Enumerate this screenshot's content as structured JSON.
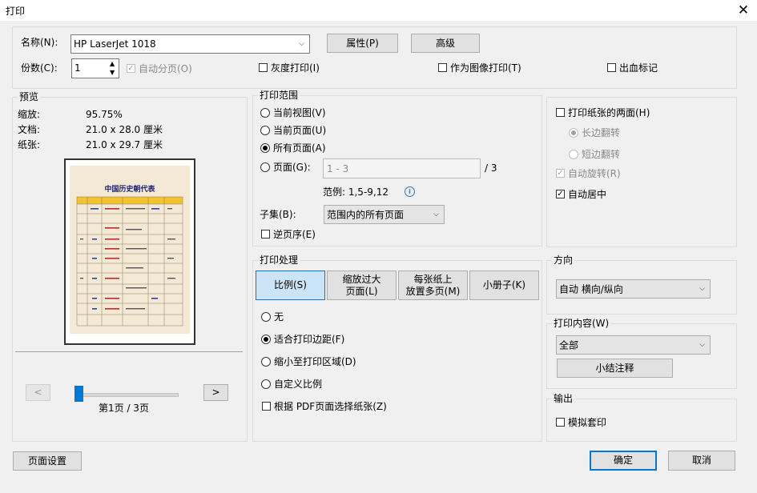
{
  "window": {
    "title": "打印",
    "close_glyph": "✕"
  },
  "printer": {
    "name_label": "名称(N):",
    "name_value": "HP LaserJet 1018",
    "properties_btn": "属性(P)",
    "advanced_btn": "高级",
    "copies_label": "份数(C):",
    "copies_value": "1",
    "collate_label": "自动分页(O)",
    "grayscale_label": "灰度打印(I)",
    "print_as_image_label": "作为图像打印(T)",
    "bleed_marks_label": "出血标记"
  },
  "preview": {
    "title": "预览",
    "zoom_label": "缩放:",
    "zoom_value": "95.75%",
    "document_label": "文档:",
    "document_value": "21.0 x 28.0 厘米",
    "paper_label": "纸张:",
    "paper_value": "21.0 x 29.7 厘米",
    "doc_heading": "中国历史朝代表",
    "prev_btn": "<",
    "next_btn": ">",
    "page_indicator": "第1页 / 3页"
  },
  "print_range": {
    "title": "打印范围",
    "current_view": "当前视图(V)",
    "current_page": "当前页面(U)",
    "all_pages": "所有页面(A)",
    "pages": "页面(G):",
    "pages_placeholder": "1 - 3",
    "pages_total": "/ 3",
    "example": "范例: 1,5-9,12",
    "info_glyph": "i",
    "subset_label": "子集(B):",
    "subset_value": "范围内的所有页面",
    "reverse_label": "逆页序(E)"
  },
  "duplex": {
    "both_sides": "打印纸张的两面(H)",
    "long_edge": "长边翻转",
    "short_edge": "短边翻转",
    "auto_rotate": "自动旋转(R)",
    "auto_center": "自动居中"
  },
  "handling": {
    "title": "打印处理",
    "tab_scale": "比例(S)",
    "tab_fit_line1": "缩放过大",
    "tab_fit_line2": "页面(L)",
    "tab_multi_line1": "每张纸上",
    "tab_multi_line2": "放置多页(M)",
    "tab_booklet": "小册子(K)",
    "opt_none": "无",
    "opt_fit_margins": "适合打印边距(F)",
    "opt_shrink": "缩小至打印区域(D)",
    "opt_custom": "自定义比例",
    "choose_paper": "根据 PDF页面选择纸张(Z)"
  },
  "orientation": {
    "title": "方向",
    "value": "自动 横向/纵向"
  },
  "content": {
    "title": "打印内容(W)",
    "value": "全部",
    "summarize_btn": "小结注释"
  },
  "output": {
    "title": "输出",
    "simulate_overprint": "模拟套印"
  },
  "footer": {
    "page_setup_btn": "页面设置",
    "ok_btn": "确定",
    "cancel_btn": "取消"
  },
  "colors": {
    "accent": "#0078d7",
    "selected_tab": "#cce4f7",
    "dialog_bg": "#f0f0f0",
    "info_icon": "#1e7bd6"
  }
}
